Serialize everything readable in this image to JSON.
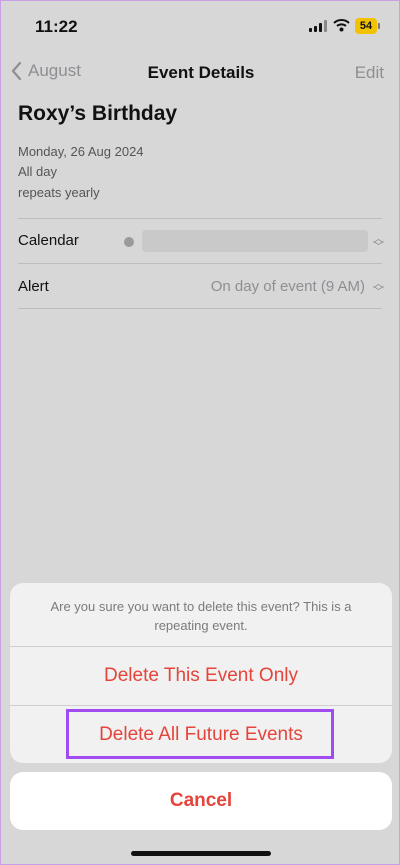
{
  "status_bar": {
    "time": "11:22",
    "battery": "54"
  },
  "nav": {
    "back_label": "August",
    "title": "Event Details",
    "edit_label": "Edit"
  },
  "event": {
    "title": "Roxy’s Birthday",
    "date": "Monday, 26 Aug 2024",
    "duration": "All day",
    "recurrence": "repeats yearly"
  },
  "rows": {
    "calendar_label": "Calendar",
    "alert_label": "Alert",
    "alert_value": "On day of event (9 AM)"
  },
  "action_sheet": {
    "message": "Are you sure you want to delete this event? This is a repeating event.",
    "delete_this_label": "Delete This Event Only",
    "delete_future_label": "Delete All Future Events",
    "cancel_label": "Cancel"
  },
  "colors": {
    "destructive": "#e5443a",
    "highlight": "#a04cf0",
    "battery": "#f2c200"
  }
}
